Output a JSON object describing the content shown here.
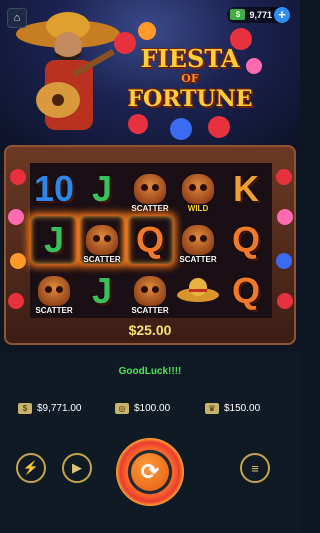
{
  "header": {
    "balance_chip": "9,771",
    "home_icon": "home-icon",
    "cash_icon": "cash-icon",
    "plus_icon": "plus-icon"
  },
  "logo": {
    "line1": "FIESTA",
    "line2": "OF",
    "line3": "FORTUNE"
  },
  "reels": [
    [
      {
        "sym": "10",
        "color": "#2f86e8"
      },
      {
        "sym": "J",
        "color": "#3bbf5a"
      },
      {
        "sym": "skull",
        "label": "SCATTER"
      },
      {
        "sym": "skull",
        "label": "WILD"
      },
      {
        "sym": "K",
        "color": "#f0a030"
      }
    ],
    [
      {
        "sym": "J",
        "color": "#3bbf5a",
        "win": true
      },
      {
        "sym": "skull",
        "label": "SCATTER",
        "win": true
      },
      {
        "sym": "Q",
        "color": "#f07a2a",
        "win": true
      },
      {
        "sym": "skull",
        "label": "SCATTER"
      },
      {
        "sym": "Q",
        "color": "#f07a2a"
      }
    ],
    [
      {
        "sym": "skull",
        "label": "SCATTER"
      },
      {
        "sym": "J",
        "color": "#3bbf5a"
      },
      {
        "sym": "skull",
        "label": "SCATTER"
      },
      {
        "sym": "sombrero",
        "label": ""
      },
      {
        "sym": "Q",
        "color": "#f07a2a"
      }
    ]
  ],
  "win_amount": "$25.00",
  "message": "GoodLuck!!!!",
  "stats": {
    "balance": "$9,771.00",
    "bet": "$100.00",
    "win": "$150.00"
  },
  "controls": {
    "turbo_icon": "lightning-icon",
    "autoplay_icon": "play-icon",
    "spin_icon": "spin-icon",
    "menu_icon": "menu-icon"
  },
  "colors": {
    "accent": "#ffcf3a",
    "win_text": "#f4e07a",
    "message": "#4ee35a"
  }
}
